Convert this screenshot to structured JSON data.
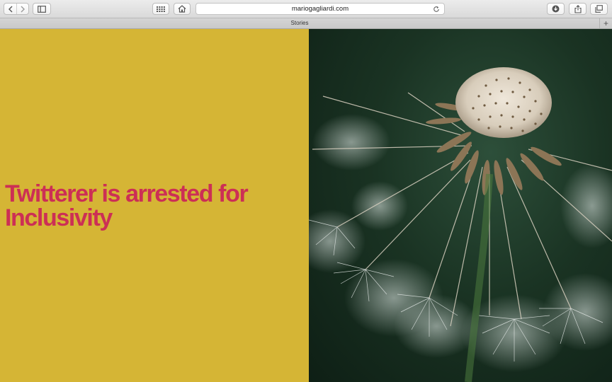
{
  "browser": {
    "url": "mariogagliardi.com",
    "tab_title": "Stories",
    "new_tab_symbol": "+"
  },
  "icons": {
    "back": "chevron-left-icon",
    "forward": "chevron-right-icon",
    "sidebar": "sidebar-icon",
    "top_sites": "grid-icon",
    "home": "home-icon",
    "reload": "reload-icon",
    "downloads": "download-icon",
    "share": "share-icon",
    "tabs": "tabs-overview-icon"
  },
  "page": {
    "headline": "Twitterer is arrested for Inclusivity",
    "colors": {
      "left_background": "#d5b535",
      "headline": "#cc2f55"
    },
    "image_subject": "dandelion seed head photograph"
  }
}
